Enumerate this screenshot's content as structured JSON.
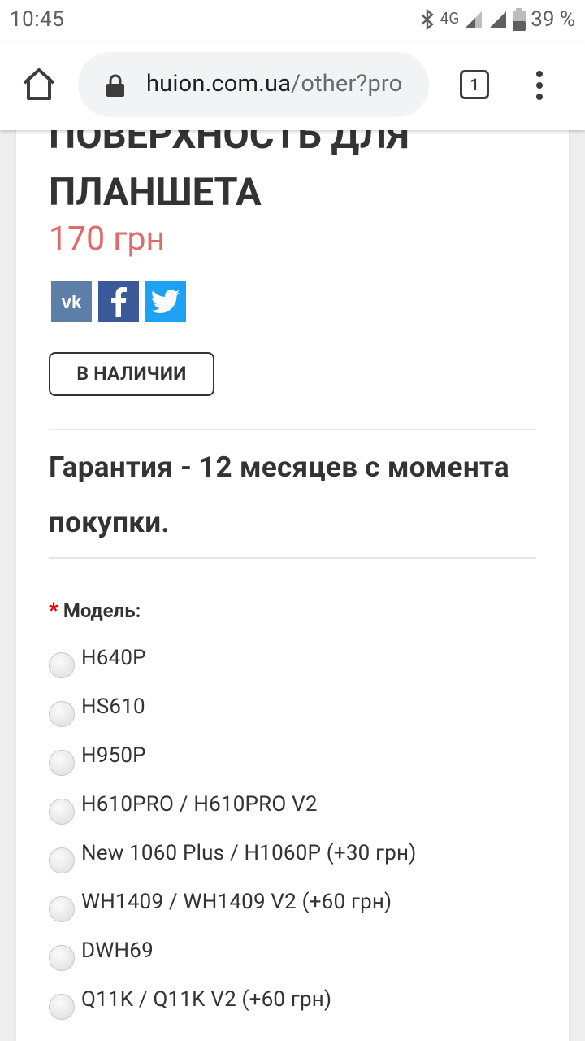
{
  "status_bar": {
    "time": "10:45",
    "network": "4G",
    "battery": "39 %"
  },
  "browser": {
    "url_domain": "huion.com.ua",
    "url_rest": "/other?pro",
    "tab_count": "1"
  },
  "product": {
    "title_line1": "ПОВЕРХНОСТЬ ДЛЯ",
    "title_line2": "ПЛАНШЕТА",
    "price": "170 грн",
    "stock_label": "В НАЛИЧИИ",
    "warranty": "Гарантия - 12 месяцев с момента покупки."
  },
  "share": {
    "vk": "vk-share",
    "facebook": "facebook-share",
    "twitter": "twitter-share"
  },
  "model": {
    "required_mark": "*",
    "label": "Модель:",
    "options": [
      "H640P",
      "HS610",
      "H950P",
      "H610PRO / H610PRO V2",
      "New 1060 Plus / H1060P (+30 грн)",
      "WH1409 / WH1409 V2 (+60 грн)",
      "DWH69",
      "Q11K / Q11K V2 (+60 грн)"
    ]
  },
  "colors": {
    "price": "#e06b6b",
    "vk": "#5b7fa6",
    "facebook": "#3b5998",
    "twitter": "#1da1f2",
    "required": "#e00000"
  }
}
